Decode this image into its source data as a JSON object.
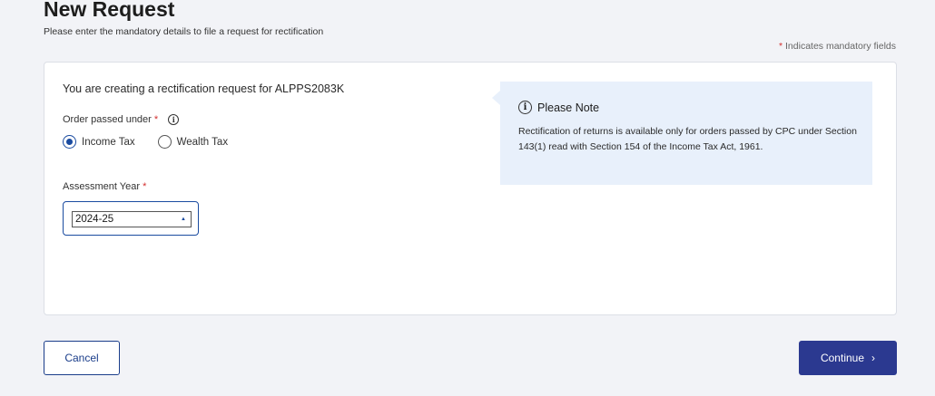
{
  "header": {
    "title": "New Request",
    "subtitle": "Please enter the mandatory details to file a request for rectification",
    "mandatory_star": "*",
    "mandatory_note": "Indicates mandatory fields"
  },
  "form": {
    "intro": "You are creating a rectification request for ALPPS2083K",
    "order_label": "Order passed under",
    "required_star": "*",
    "info_glyph": "i",
    "radio_options": [
      {
        "label": "Income Tax",
        "checked": true
      },
      {
        "label": "Wealth Tax",
        "checked": false
      }
    ],
    "assessment_year_label": "Assessment Year",
    "assessment_year_value": "2024-25",
    "select_arrow": "▲"
  },
  "note": {
    "title": "Please Note",
    "text": "Rectification of returns is available only for orders passed by CPC under Section 143(1) read with Section 154 of the Income Tax Act, 1961."
  },
  "actions": {
    "cancel_label": "Cancel",
    "continue_label": "Continue",
    "continue_chevron": "›"
  },
  "colors": {
    "primary": "#2b3990",
    "required": "#d32f2f",
    "note_bg": "#e8f0fb"
  }
}
